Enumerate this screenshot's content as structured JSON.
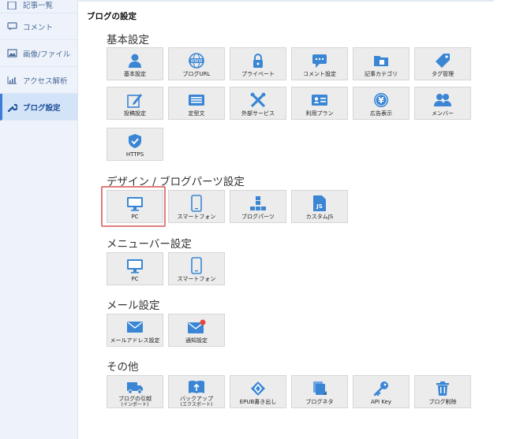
{
  "colors": {
    "accent": "#3a86d4",
    "sidebar_bg": "#eef3fb",
    "highlight": "#e07d7d",
    "badge": "#e8473f"
  },
  "sidebar": {
    "items": [
      {
        "label": "記事一覧",
        "icon": "document-icon"
      },
      {
        "label": "コメント",
        "icon": "comment-icon"
      },
      {
        "label": "画像/ファイル",
        "icon": "image-icon"
      },
      {
        "label": "アクセス解析",
        "icon": "chart-icon"
      },
      {
        "label": "ブログ設定",
        "icon": "wrench-icon",
        "active": true
      }
    ]
  },
  "page_title": "ブログの設定",
  "sections": [
    {
      "title": "基本設定",
      "tiles": [
        {
          "label": "基本設定",
          "icon": "user-icon"
        },
        {
          "label": "ブログURL",
          "icon": "www-icon"
        },
        {
          "label": "プライベート",
          "icon": "lock-icon"
        },
        {
          "label": "コメント設定",
          "icon": "comment-icon"
        },
        {
          "label": "記事カテゴリ",
          "icon": "folder-icon"
        },
        {
          "label": "タグ管理",
          "icon": "tag-icon"
        },
        {
          "label": "投稿設定",
          "icon": "pencil-icon"
        },
        {
          "label": "定型文",
          "icon": "keyboard-icon"
        },
        {
          "label": "外部サービス",
          "icon": "tools-icon"
        },
        {
          "label": "利用プラン",
          "icon": "id-card-icon"
        },
        {
          "label": "広告表示",
          "icon": "yen-icon"
        },
        {
          "label": "メンバー",
          "icon": "members-icon"
        },
        {
          "label": "HTTPS",
          "icon": "shield-icon"
        }
      ]
    },
    {
      "title": "デザイン / ブログパーツ設定",
      "tiles": [
        {
          "label": "PC",
          "icon": "monitor-icon",
          "selected": true
        },
        {
          "label": "スマートフォン",
          "icon": "smartphone-icon"
        },
        {
          "label": "ブログパーツ",
          "icon": "blog-parts-icon"
        },
        {
          "label": "カスタムJS",
          "icon": "js-file-icon"
        }
      ]
    },
    {
      "title": "メニューバー設定",
      "tiles": [
        {
          "label": "PC",
          "icon": "monitor-icon"
        },
        {
          "label": "スマートフォン",
          "icon": "smartphone-icon"
        }
      ]
    },
    {
      "title": "メール設定",
      "tiles": [
        {
          "label": "メールアドレス設定",
          "icon": "mail-icon"
        },
        {
          "label": "通知設定",
          "icon": "mail-notify-icon"
        }
      ]
    },
    {
      "title": "その他",
      "tiles": [
        {
          "label": "ブログの引越",
          "sublabel": "(インポート)",
          "icon": "truck-icon"
        },
        {
          "label": "バックアップ",
          "sublabel": "(エクスポート)",
          "icon": "book-upload-icon"
        },
        {
          "label": "EPUB書き出し",
          "icon": "epub-icon"
        },
        {
          "label": "ブログネタ",
          "icon": "papers-icon"
        },
        {
          "label": "API Key",
          "icon": "key-icon"
        },
        {
          "label": "ブログ削除",
          "icon": "trash-icon"
        }
      ]
    }
  ]
}
